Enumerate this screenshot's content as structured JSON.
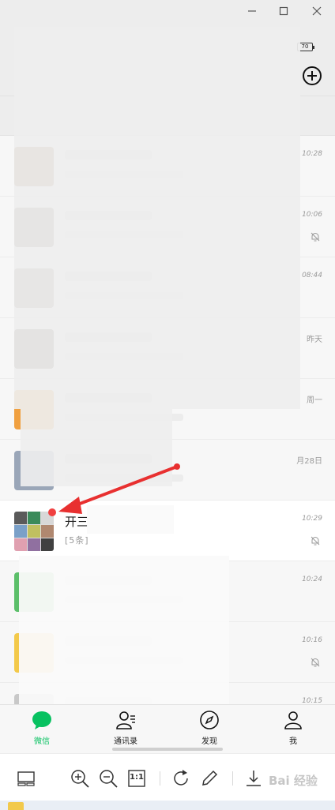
{
  "window": {
    "min_icon": "minimize-icon",
    "max_icon": "maximize-icon",
    "close_icon": "close-icon"
  },
  "header": {
    "battery": "70",
    "add_icon": "plus-circle-icon"
  },
  "chats": [
    {
      "name": "",
      "time": "10:28",
      "muted": false
    },
    {
      "name": "",
      "time": "10:06",
      "muted": true
    },
    {
      "name": "",
      "time": "08:44",
      "muted": false
    },
    {
      "name": "",
      "time": "昨天",
      "muted": false
    },
    {
      "name": "",
      "time": "周一",
      "muted": false
    },
    {
      "name": "",
      "time": "月28日",
      "muted": false
    },
    {
      "name": "开三",
      "preview": "[5条]",
      "time": "10:29",
      "muted": true,
      "unread_dot": true
    },
    {
      "name": "",
      "time": "10:24",
      "muted": false
    },
    {
      "name": "",
      "time": "10:16",
      "muted": true
    },
    {
      "name": "",
      "time": "10:15",
      "muted": false
    }
  ],
  "nav": {
    "chats": "微信",
    "contacts": "通讯录",
    "discover": "发现",
    "me": "我"
  },
  "toolbar": {
    "ratio": "1:1"
  },
  "watermark": "Bai 经验",
  "colors": {
    "accent": "#07c160",
    "badge": "#f04040",
    "arrow": "#e83030"
  }
}
